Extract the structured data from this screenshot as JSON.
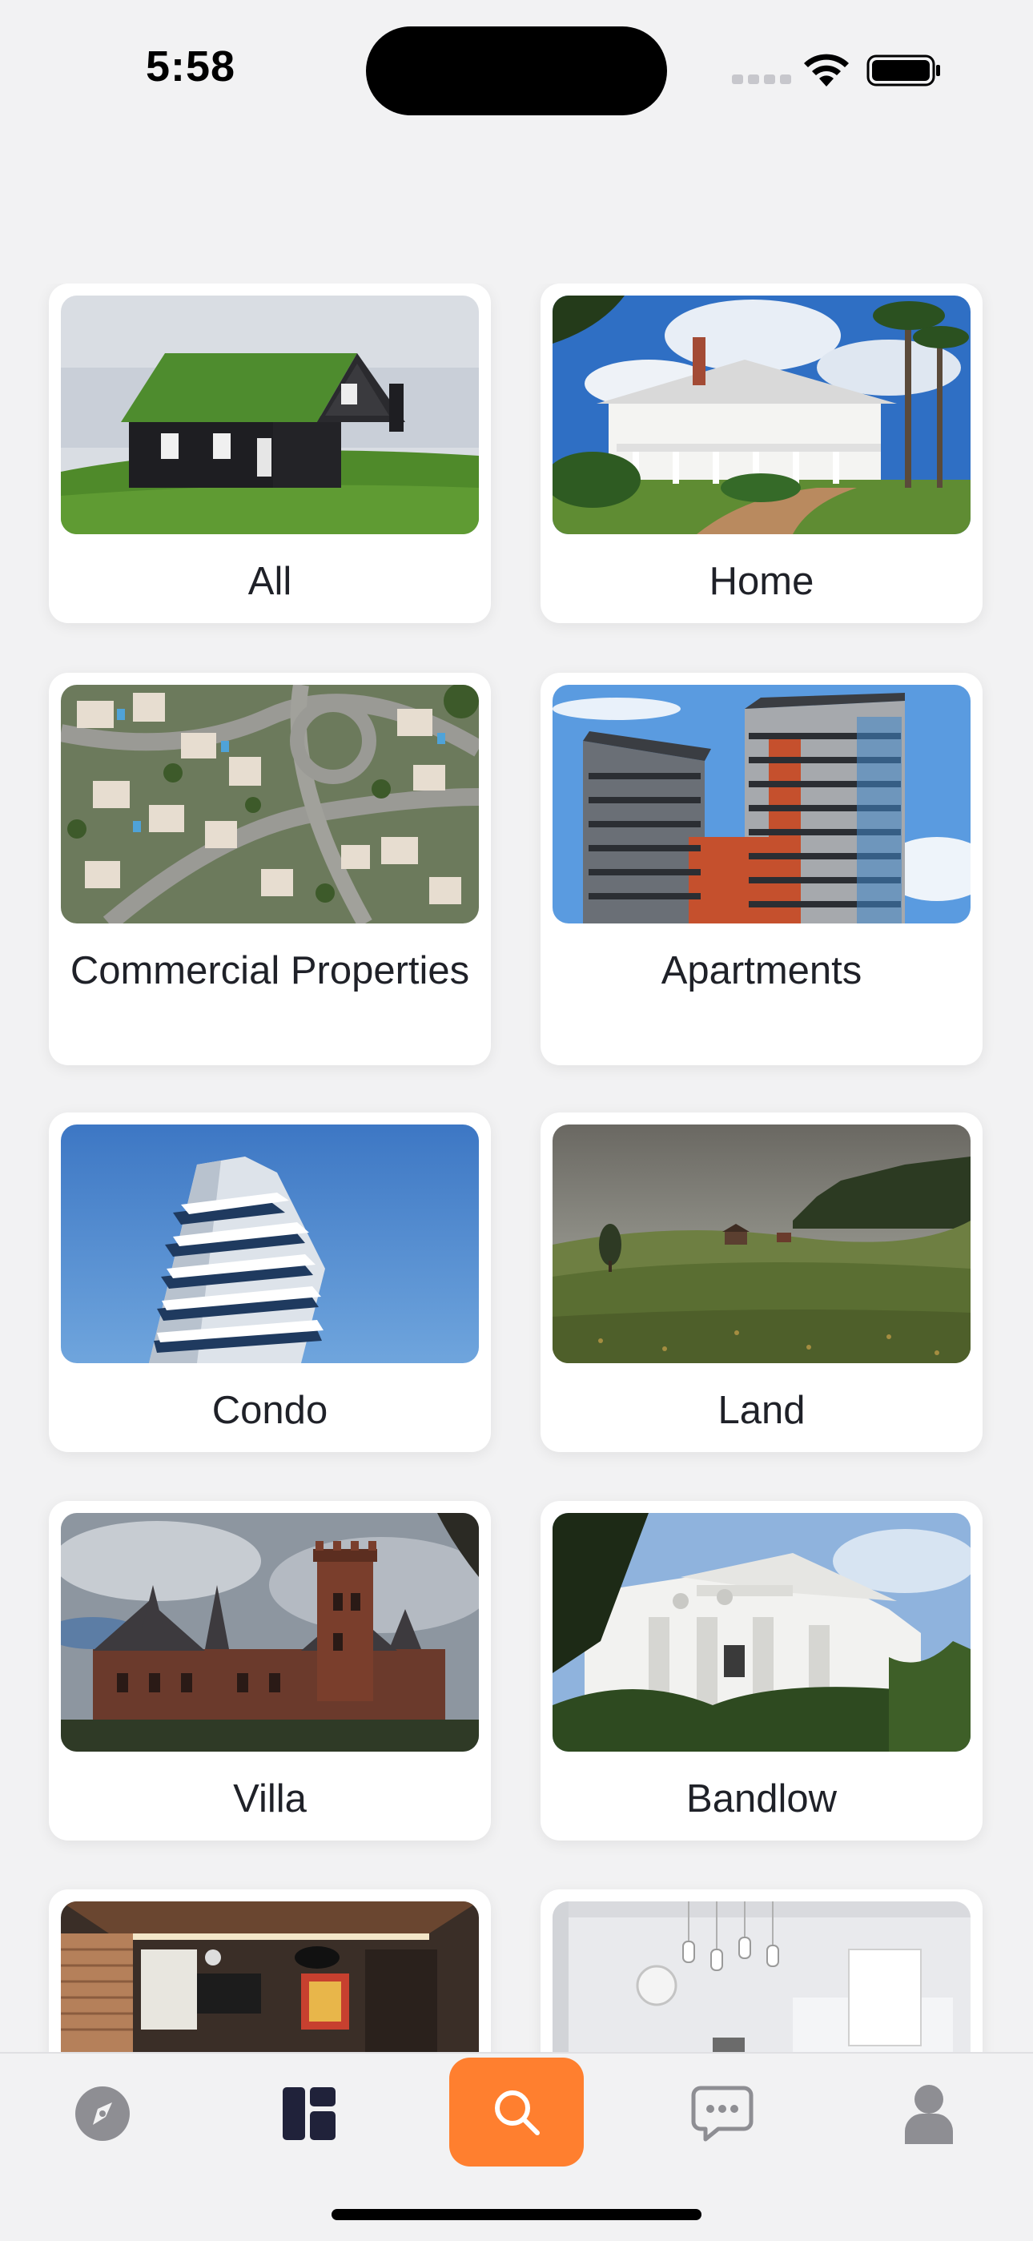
{
  "status_bar": {
    "time": "5:58"
  },
  "categories": [
    {
      "label": "All",
      "image": "house-with-grass-roof"
    },
    {
      "label": "Home",
      "image": "white-mansion-with-palms"
    },
    {
      "label": "Commercial Properties",
      "image": "aerial-neighborhood"
    },
    {
      "label": "Apartments",
      "image": "apartment-towers"
    },
    {
      "label": "Condo",
      "image": "modern-condo-tower"
    },
    {
      "label": "Land",
      "image": "green-meadow"
    },
    {
      "label": "Villa",
      "image": "brick-castle-villa"
    },
    {
      "label": "Bandlow",
      "image": "white-classical-building"
    },
    {
      "label": "",
      "image": "living-room-interior"
    },
    {
      "label": "",
      "image": "white-kitchen-interior"
    }
  ],
  "tab_bar": {
    "tabs": [
      {
        "icon": "compass-icon"
      },
      {
        "icon": "dashboard-icon"
      },
      {
        "icon": "search-icon",
        "active": true
      },
      {
        "icon": "chat-icon"
      },
      {
        "icon": "profile-icon"
      }
    ],
    "accent_color": "#ff7f2f"
  }
}
